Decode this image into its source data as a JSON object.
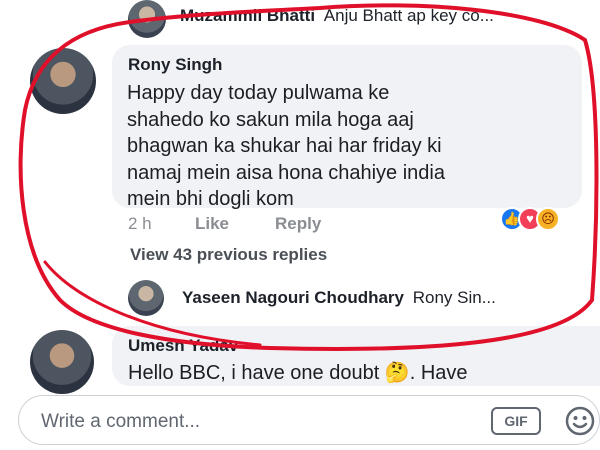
{
  "top_reply": {
    "author": "Muzammil Bhatti",
    "snippet": "Anju Bhatt ap key co..."
  },
  "main_comment": {
    "author": "Rony Singh",
    "text": "Happy day today pulwama ke\nshahedo ko sakun mila hoga aaj\nbhagwan ka shukar hai har friday ki\nnamaj mein aisa hona chahiye india\nmein bhi dogli kom",
    "time": "2 h",
    "like_label": "Like",
    "reply_label": "Reply",
    "reactions": [
      "like-reaction",
      "love-reaction",
      "angry-reaction"
    ],
    "view_replies_label": "View 43 previous replies"
  },
  "bottom_reply": {
    "author": "Yaseen Nagouri Choudhary",
    "snippet": "Rony Sin..."
  },
  "second_comment": {
    "author": "Umesh Yadav",
    "text": "Hello BBC, i have one doubt 🤔. Have"
  },
  "composer": {
    "placeholder": "Write a comment...",
    "gif_label": "GIF"
  },
  "colors": {
    "bubble": "#f0f2f5",
    "like_blue": "#1877f2",
    "love_red": "#f33e58",
    "angry_orange": "#f7b125",
    "annotation_red": "#e0102a"
  }
}
